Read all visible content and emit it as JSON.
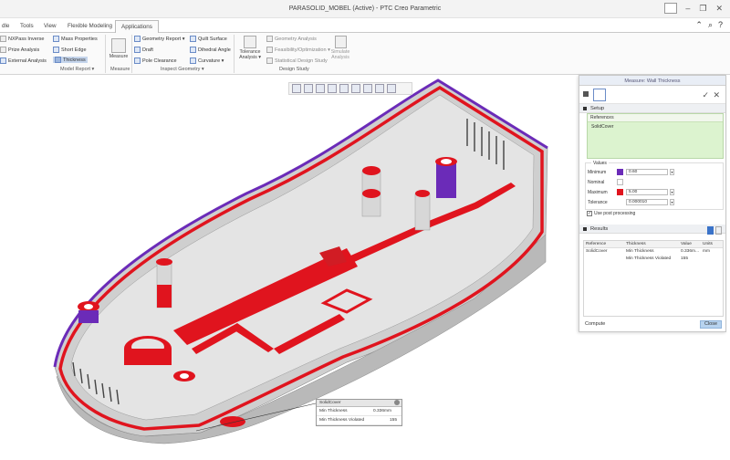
{
  "window": {
    "title": "PARASOLID_MOBEL (Active) - PTC Creo Parametric",
    "controls": [
      "–",
      "❐",
      "✕"
    ]
  },
  "tabs": [
    "Tools",
    "View",
    "Flexible Modeling",
    "Applications"
  ],
  "tab_prefix": "dle",
  "ribbon": {
    "model_report": {
      "items": [
        "NXPass Inverse",
        "Prize Analysis",
        "External Analysis",
        "Mass Properties",
        "Short Edge",
        "Thickness"
      ],
      "label": "Model Report ▾"
    },
    "measure": {
      "button": "Measure",
      "label": "Measure"
    },
    "inspect_geometry": {
      "items": [
        "Geometry Report ▾",
        "Draft",
        "Pole Clearance",
        "Quilt Surface",
        "Dihedral Angle",
        "Curvature ▾"
      ],
      "label": "Inspect Geometry ▾"
    },
    "design_study": {
      "items": [
        "Tolerance Analysis ▾",
        "Geometry Analysis",
        "Feasibility/Optimization ▾",
        "Statistical Design Study",
        "Simulate Analysis"
      ],
      "label": "Design Study"
    }
  },
  "panel": {
    "title": "Measure: Wall Thickness",
    "setup_label": "Setup",
    "references_label": "References",
    "references_value": "SolidCover",
    "values_label": "Values",
    "minimum_label": "Minimum",
    "minimum_value": "0.60",
    "nominal_label": "Nominal",
    "maximum_label": "Maximum",
    "maximum_value": "5.00",
    "tolerance_label": "Tolerance",
    "tolerance_value": "0.000010",
    "use_post_processing": "Use post processing",
    "results_label": "Results",
    "columns": [
      "Reference",
      "Thickness",
      "Value",
      "Units"
    ],
    "rows": [
      {
        "reference": "SolidCover",
        "thickness": "Min Thickness",
        "value": "0.336m...",
        "units": "mm"
      },
      {
        "reference": "",
        "thickness": "Min Thickness Violated",
        "value": "155",
        "units": ""
      }
    ],
    "compute": "Compute",
    "close": "Close"
  },
  "tooltip": {
    "title": "SolidCover",
    "rows": [
      {
        "label": "Min Thickness",
        "value": "0.336mm"
      },
      {
        "label": "Min Thickness Violated",
        "value": "155"
      }
    ]
  },
  "colors": {
    "model_grey": "#d6d6d6",
    "violation_red": "#e0141e",
    "purple": "#6b2bb8"
  }
}
